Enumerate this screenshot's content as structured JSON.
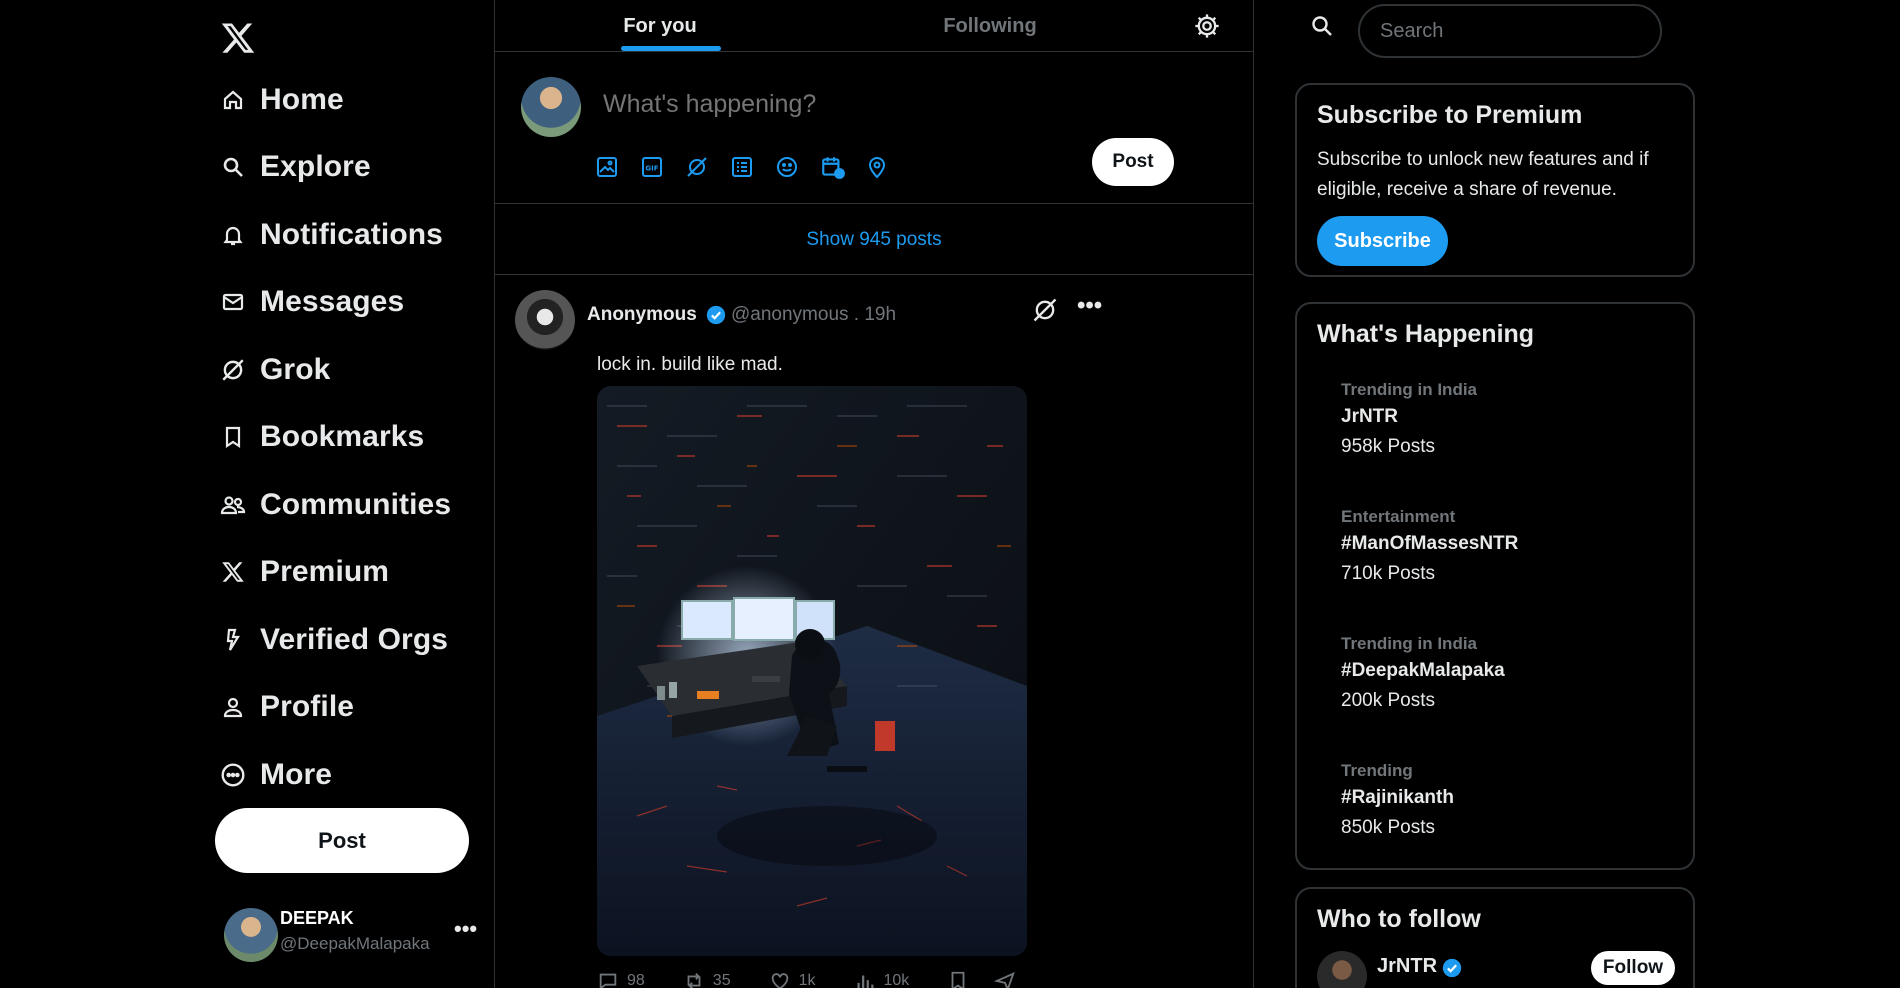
{
  "nav": {
    "items": [
      {
        "label": "Home",
        "icon": "home-icon"
      },
      {
        "label": "Explore",
        "icon": "search-icon"
      },
      {
        "label": "Notifications",
        "icon": "bell-icon"
      },
      {
        "label": "Messages",
        "icon": "envelope-icon"
      },
      {
        "label": "Grok",
        "icon": "grok-icon"
      },
      {
        "label": "Bookmarks",
        "icon": "bookmark-icon"
      },
      {
        "label": "Communities",
        "icon": "people-icon"
      },
      {
        "label": "Premium",
        "icon": "x-logo-icon"
      },
      {
        "label": "Verified Orgs",
        "icon": "lightning-icon"
      },
      {
        "label": "Profile",
        "icon": "person-icon"
      },
      {
        "label": "More",
        "icon": "more-circle-icon"
      }
    ],
    "post_label": "Post"
  },
  "account": {
    "name": "DEEPAK",
    "handle": "@DeepakMalapaka",
    "more": "•••"
  },
  "feed": {
    "tabs": [
      {
        "label": "For you",
        "active": true
      },
      {
        "label": "Following",
        "active": false
      }
    ],
    "composer": {
      "placeholder": "What's happening?",
      "post_label": "Post"
    },
    "show_posts": "Show 945 posts",
    "tweet": {
      "author": "Anonymous",
      "handle": "@anonymous . 19h",
      "text": "lock in. build like mad.",
      "more": "•••",
      "stats": {
        "replies": "98",
        "reposts": "35",
        "likes": "1k",
        "views": "10k"
      }
    }
  },
  "right": {
    "search_placeholder": "Search",
    "premium": {
      "title": "Subscribe to Premium",
      "body": "Subscribe to unlock new features and if eligible, receive a share of revenue.",
      "button": "Subscribe"
    },
    "trends": {
      "title": "What's Happening",
      "items": [
        {
          "context": "Trending in India",
          "topic": "JrNTR",
          "count": "958k Posts"
        },
        {
          "context": "Entertainment",
          "topic": "#ManOfMassesNTR",
          "count": "710k Posts"
        },
        {
          "context": "Trending in India",
          "topic": "#DeepakMalapaka",
          "count": "200k Posts"
        },
        {
          "context": "Trending",
          "topic": "#Rajinikanth",
          "count": "850k Posts"
        }
      ]
    },
    "who_to_follow": {
      "title": "Who to follow",
      "account": {
        "name": "JrNTR"
      },
      "button": "Follow"
    }
  },
  "colors": {
    "accent": "#1d9bf0",
    "background": "#000000",
    "border": "#2f3336",
    "muted": "#71767b"
  }
}
